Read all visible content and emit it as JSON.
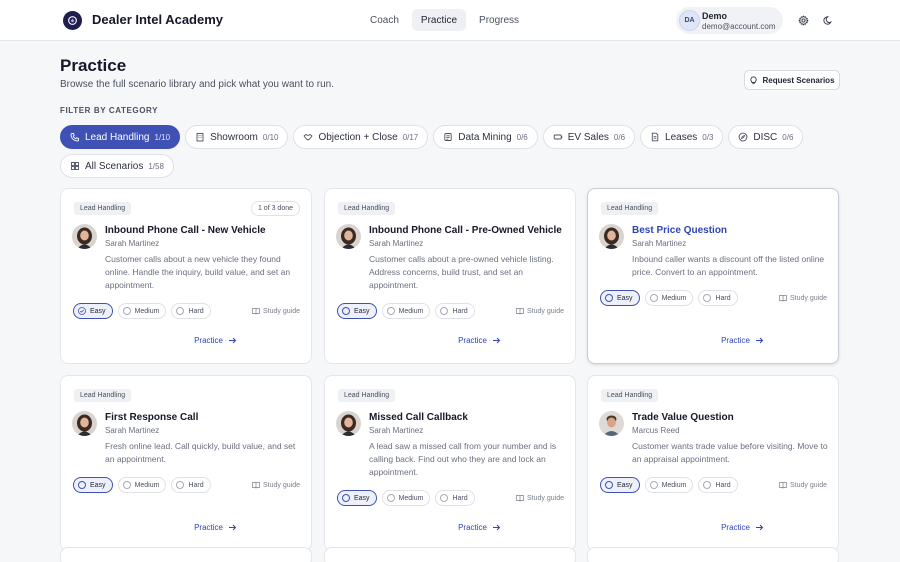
{
  "app": {
    "brand": "Dealer Intel Academy"
  },
  "nav": {
    "tabs": [
      {
        "label": "Coach"
      },
      {
        "label": "Practice"
      },
      {
        "label": "Progress"
      }
    ]
  },
  "user": {
    "initials": "DA",
    "name": "Demo",
    "email": "demo@account.com"
  },
  "page": {
    "title": "Practice",
    "subtitle": "Browse the full scenario library and pick what you want to run.",
    "request_button": "Request Scenarios",
    "filter_label": "FILTER BY CATEGORY"
  },
  "filters": [
    {
      "label": "Lead Handling",
      "count": "1/10",
      "icon": "phone-icon"
    },
    {
      "label": "Showroom",
      "count": "0/10",
      "icon": "building-icon"
    },
    {
      "label": "Objection + Close",
      "count": "0/17",
      "icon": "handshake-icon"
    },
    {
      "label": "Data Mining",
      "count": "0/6",
      "icon": "database-icon"
    },
    {
      "label": "EV Sales",
      "count": "0/6",
      "icon": "battery-icon"
    },
    {
      "label": "Leases",
      "count": "0/3",
      "icon": "document-icon"
    },
    {
      "label": "DISC",
      "count": "0/6",
      "icon": "compass-icon"
    },
    {
      "label": "All Scenarios",
      "count": "1/58",
      "icon": "grid-icon"
    }
  ],
  "levels": {
    "easy": "Easy",
    "medium": "Medium",
    "hard": "Hard"
  },
  "card_labels": {
    "study_guide": "Study guide",
    "practice": "Practice"
  },
  "cards": [
    {
      "tag": "Lead Handling",
      "progress": "1 of 3 done",
      "title": "Inbound Phone Call - New Vehicle",
      "person": "Sarah Martinez",
      "description": "Customer calls about a new vehicle they found online. Handle the inquiry, build value, and set an appointment.",
      "selected_level": "Easy",
      "easy_completed": true
    },
    {
      "tag": "Lead Handling",
      "title": "Inbound Phone Call - Pre-Owned Vehicle",
      "person": "Sarah Martinez",
      "description": "Customer calls about a pre-owned vehicle listing. Address concerns, build trust, and set an appointment.",
      "selected_level": "Easy"
    },
    {
      "tag": "Lead Handling",
      "title": "Best Price Question",
      "person": "Sarah Martinez",
      "description": "Inbound caller wants a discount off the listed online price. Convert to an appointment.",
      "selected_level": "Easy"
    },
    {
      "tag": "Lead Handling",
      "title": "First Response Call",
      "person": "Sarah Martinez",
      "description": "Fresh online lead. Call quickly, build value, and set an appointment.",
      "selected_level": "Easy"
    },
    {
      "tag": "Lead Handling",
      "title": "Missed Call Callback",
      "person": "Sarah Martinez",
      "description": "A lead saw a missed call from your number and is calling back. Find out who they are and lock an appointment.",
      "selected_level": "Easy"
    },
    {
      "tag": "Lead Handling",
      "title": "Trade Value Question",
      "person": "Marcus Reed",
      "description": "Customer wants trade value before visiting. Move to an appraisal appointment.",
      "selected_level": "Easy"
    }
  ],
  "colors": {
    "accent": "#3f51b5",
    "link": "#2f44b6",
    "background": "#f6f7f9"
  }
}
